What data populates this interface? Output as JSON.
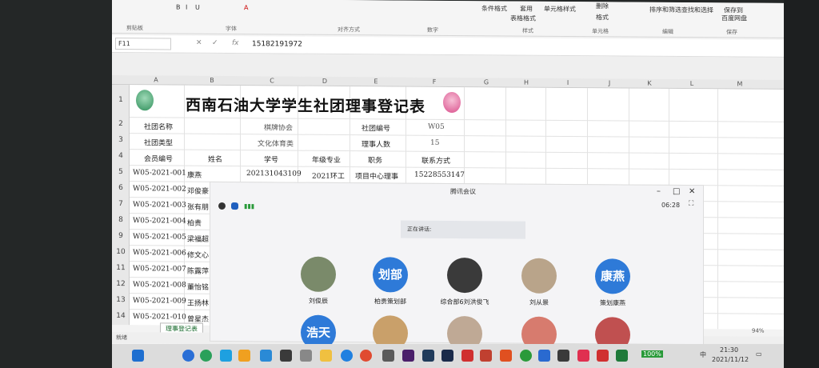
{
  "ribbon": {
    "top_items": [
      "B",
      "I",
      "U",
      "A",
      "条件格式",
      "套用",
      "单元格样式",
      "删除",
      "排序和筛选",
      "查找和选择",
      "保存到",
      "表格格式",
      "格式",
      "百度网盘"
    ],
    "groups": [
      "剪贴板",
      "字体",
      "对齐方式",
      "数字",
      "样式",
      "单元格",
      "编辑",
      "保存"
    ]
  },
  "formula_bar": {
    "name_box": "F11",
    "fx_label": "fx",
    "value": "15182191972"
  },
  "columns": [
    "A",
    "B",
    "C",
    "D",
    "E",
    "F",
    "G",
    "H",
    "I",
    "J",
    "K",
    "L",
    "M"
  ],
  "rows": [
    "1",
    "2",
    "3",
    "4",
    "5",
    "6",
    "7",
    "8",
    "9",
    "10",
    "11",
    "12",
    "13",
    "14"
  ],
  "sheet": {
    "title": "西南石油大学学生社团理事登记表",
    "info": {
      "club_name_label": "社团名称",
      "club_name": "棋牌协会",
      "club_id_label": "社团编号",
      "club_id": "W05",
      "club_type_label": "社团类型",
      "club_type": "文化体育类",
      "board_count_label": "理事人数",
      "board_count": "15"
    },
    "headers": [
      "会员编号",
      "姓名",
      "学号",
      "年级专业",
      "职务",
      "联系方式"
    ],
    "first_row": [
      "W05-2021-001",
      "康燕",
      "202131043109",
      "2021环工",
      "项目中心理事",
      "15228553147"
    ],
    "members": [
      {
        "id": "W05-2021-002",
        "name": "邓俊豪"
      },
      {
        "id": "W05-2021-003",
        "name": "张有朋"
      },
      {
        "id": "W05-2021-004",
        "name": "柏贵"
      },
      {
        "id": "W05-2021-005",
        "name": "梁福超"
      },
      {
        "id": "W05-2021-006",
        "name": "修文心"
      },
      {
        "id": "W05-2021-007",
        "name": "陈露萍"
      },
      {
        "id": "W05-2021-008",
        "name": "董怡铭"
      },
      {
        "id": "W05-2021-009",
        "name": "王扬林"
      },
      {
        "id": "W05-2021-010",
        "name": "曾星杰"
      }
    ],
    "tab": "理事登记表",
    "status": "就绪"
  },
  "meeting": {
    "title": "腾讯会议",
    "timer": "06:28",
    "speaking_label": "正在讲话:",
    "participants": [
      {
        "name": "刘俊辰",
        "avatar_text": "",
        "avatar_color": "#7a8a6a"
      },
      {
        "name": "柏贵策划部",
        "avatar_text": "划部",
        "avatar_color": "#2e7ad8"
      },
      {
        "name": "综合部6刘洪俊飞",
        "avatar_text": "",
        "avatar_color": "#3a3a3a"
      },
      {
        "name": "刘从景",
        "avatar_text": "",
        "avatar_color": "#b9a48a"
      },
      {
        "name": "策划康燕",
        "avatar_text": "康燕",
        "avatar_color": "#2e7ad8"
      }
    ],
    "second_row": [
      {
        "avatar_text": "浩天",
        "avatar_color": "#2e7ad8"
      },
      {
        "avatar_text": "",
        "avatar_color": "#c9a06a"
      },
      {
        "avatar_text": "",
        "avatar_color": "#bfa995"
      },
      {
        "avatar_text": "",
        "avatar_color": "#d77b6e"
      },
      {
        "avatar_text": "",
        "avatar_color": "#c05050"
      }
    ]
  },
  "zoom": "94%",
  "taskbar": {
    "time": "21:30",
    "date": "2021/11/12",
    "battery": "100%",
    "lang": "中"
  }
}
